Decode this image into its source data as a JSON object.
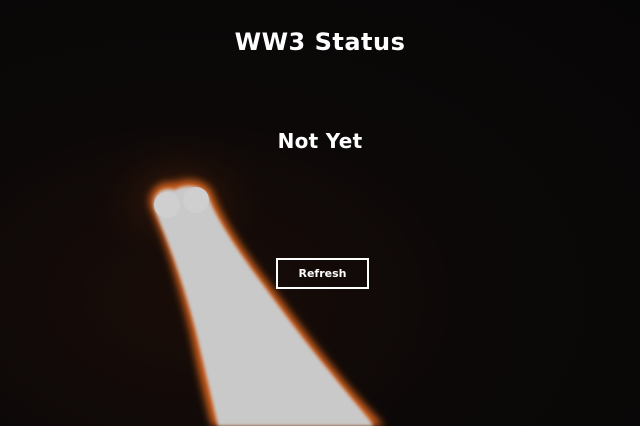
{
  "header": {
    "title": "WW3 Status"
  },
  "main": {
    "status_text": "Not Yet",
    "refresh_label": "Refresh"
  },
  "background": {
    "description_icon": "rocket-launch-exhaust-photo",
    "colors": {
      "sky": "#0a0707",
      "flame_core": "#c8c8c8",
      "flame_edge": "#e0671a"
    }
  }
}
